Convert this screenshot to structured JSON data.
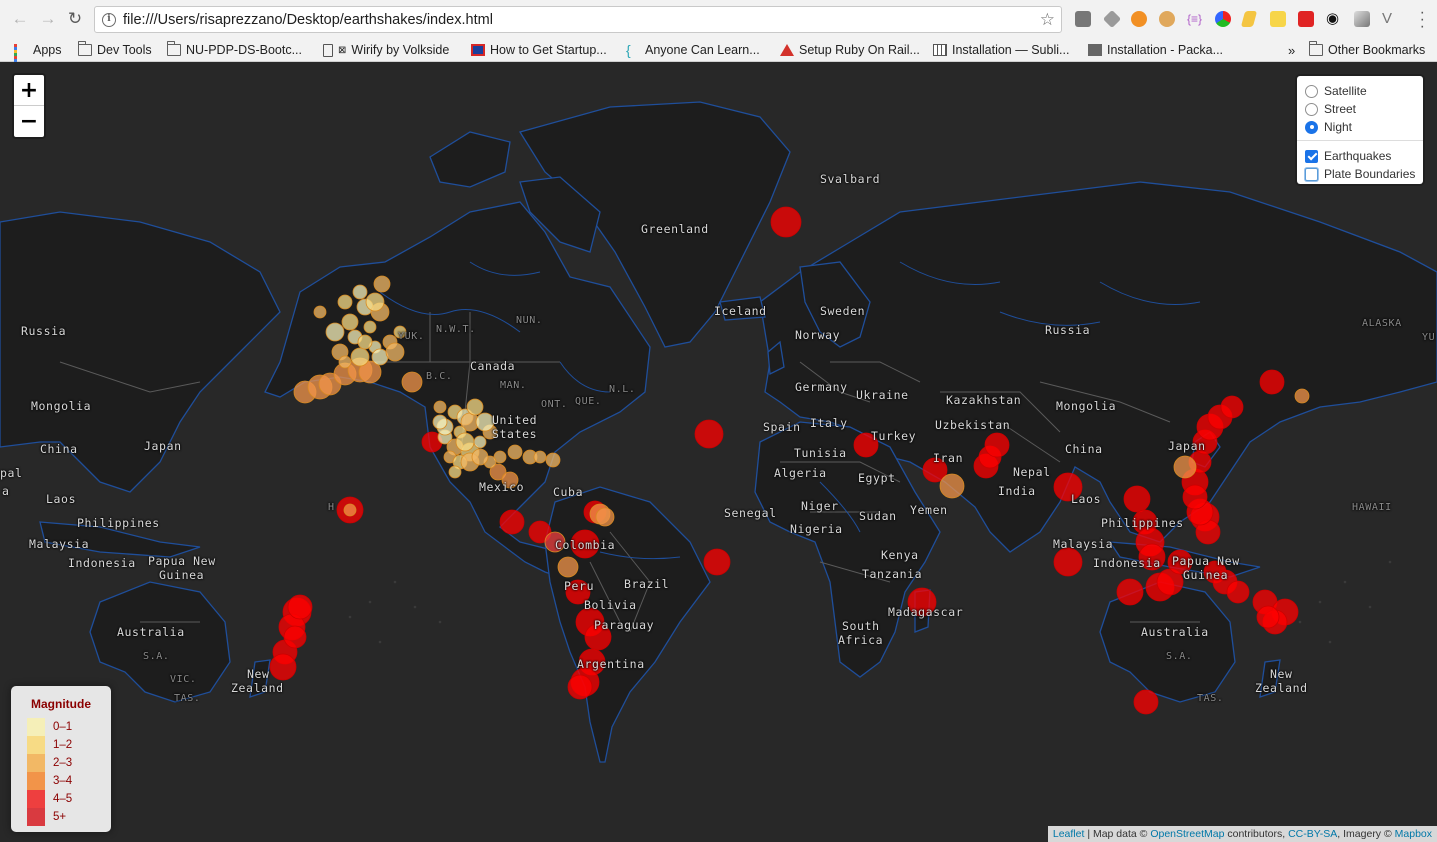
{
  "browser": {
    "url": "file:///Users/risaprezzano/Desktop/earthshakes/index.html",
    "bookmarks": [
      "Apps",
      "Dev Tools",
      "NU-PDP-DS-Bootc...",
      "Wirify by Volkside",
      "How to Get Startup...",
      "Anyone Can Learn...",
      "Setup Ruby On Rail...",
      "Installation — Subli...",
      "Installation - Packa..."
    ],
    "bookmarks_overflow": "»",
    "other_bookmarks": "Other Bookmarks"
  },
  "map": {
    "zoom_in_label": "+",
    "zoom_out_label": "−",
    "base_layers": [
      {
        "label": "Satellite",
        "selected": false
      },
      {
        "label": "Street",
        "selected": false
      },
      {
        "label": "Night",
        "selected": true
      }
    ],
    "overlays": [
      {
        "label": "Earthquakes",
        "checked": true
      },
      {
        "label": "Plate Boundaries",
        "checked": false
      }
    ],
    "legend": {
      "title": "Magnitude",
      "items": [
        {
          "label": "0–1",
          "color": "#f5efb8"
        },
        {
          "label": "1–2",
          "color": "#f7db85"
        },
        {
          "label": "2–3",
          "color": "#f2b865"
        },
        {
          "label": "3–4",
          "color": "#f29449"
        },
        {
          "label": "4–5",
          "color": "#ee3f3f"
        },
        {
          "label": "5+",
          "color": "#d93a40"
        }
      ]
    },
    "place_labels": [
      "Russia",
      "Mongolia",
      "China",
      "Japan",
      "pal",
      "Laos",
      "Philippines",
      "Malaysia",
      "Indonesia",
      "Papua New",
      "Guinea",
      "Australia",
      "S.A.",
      "VIC.",
      "TAS.",
      "New",
      "Zealand",
      "YUK.",
      "N.W.T.",
      "NUN.",
      "B.C.",
      "Canada",
      "MAN.",
      "ONT.",
      "QUE.",
      "N.L.",
      "United",
      "States",
      "Mexico",
      "Cuba",
      "Colombia",
      "Peru",
      "Brazil",
      "Bolivia",
      "Paraguay",
      "Argentina",
      "Greenland",
      "Iceland",
      "Svalbard",
      "Sweden",
      "Norway",
      "Germany",
      "Ukraine",
      "Spain",
      "Italy",
      "Turkey",
      "Tunisia",
      "Algeria",
      "Egypt",
      "Senegal",
      "Niger",
      "Nigeria",
      "Sudan",
      "Yemen",
      "Kenya",
      "Tanzania",
      "South",
      "Africa",
      "Madagascar",
      "Kazakhstan",
      "Uzbekistan",
      "Iran",
      "Nepal",
      "India",
      "Russia",
      "Mongolia",
      "China",
      "Japan",
      "Laos",
      "Philippines",
      "Malaysia",
      "Indonesia",
      "Papua New",
      "Guinea",
      "Australia",
      "S.A.",
      "TAS.",
      "New",
      "Zealand",
      "ALASKA",
      "YU",
      "HAWAII",
      "H",
      "a"
    ],
    "attribution": {
      "leaflet": "Leaflet",
      "map_data": "| Map data ©",
      "osm": "OpenStreetMap",
      "contributors": "contributors,",
      "license": "CC-BY-SA",
      "imagery": ", Imagery ©",
      "mapbox": "Mapbox"
    },
    "colors": {
      "background": "#282828",
      "land": "#1d1d1d",
      "water_lines": "#1f4e9a",
      "borders": "#5a5a5a"
    }
  }
}
